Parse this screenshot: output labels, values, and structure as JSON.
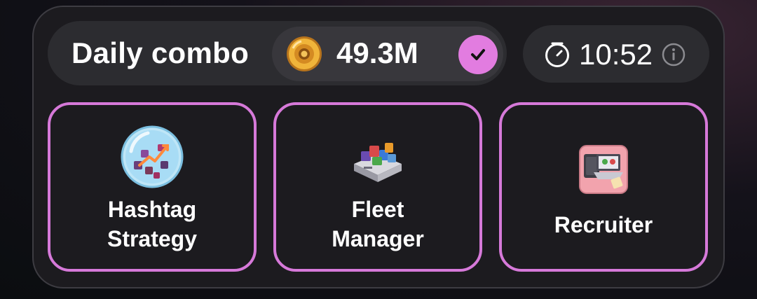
{
  "header": {
    "title": "Daily combo",
    "reward_value": "49.3M",
    "reward_icon": "coin-icon",
    "claimed_icon": "checkmark-icon"
  },
  "timer": {
    "value": "10:52",
    "icon": "clock-icon",
    "info_icon": "info-icon"
  },
  "cards": [
    {
      "label": "Hashtag\nStrategy",
      "icon": "hashtag-strategy-icon"
    },
    {
      "label": "Fleet\nManager",
      "icon": "fleet-manager-icon"
    },
    {
      "label": "Recruiter",
      "icon": "recruiter-icon"
    }
  ],
  "colors": {
    "accent": "#e27ce0",
    "card_border": "#d679d9",
    "panel": "#1c1b1f",
    "pill": "#2c2c30"
  }
}
